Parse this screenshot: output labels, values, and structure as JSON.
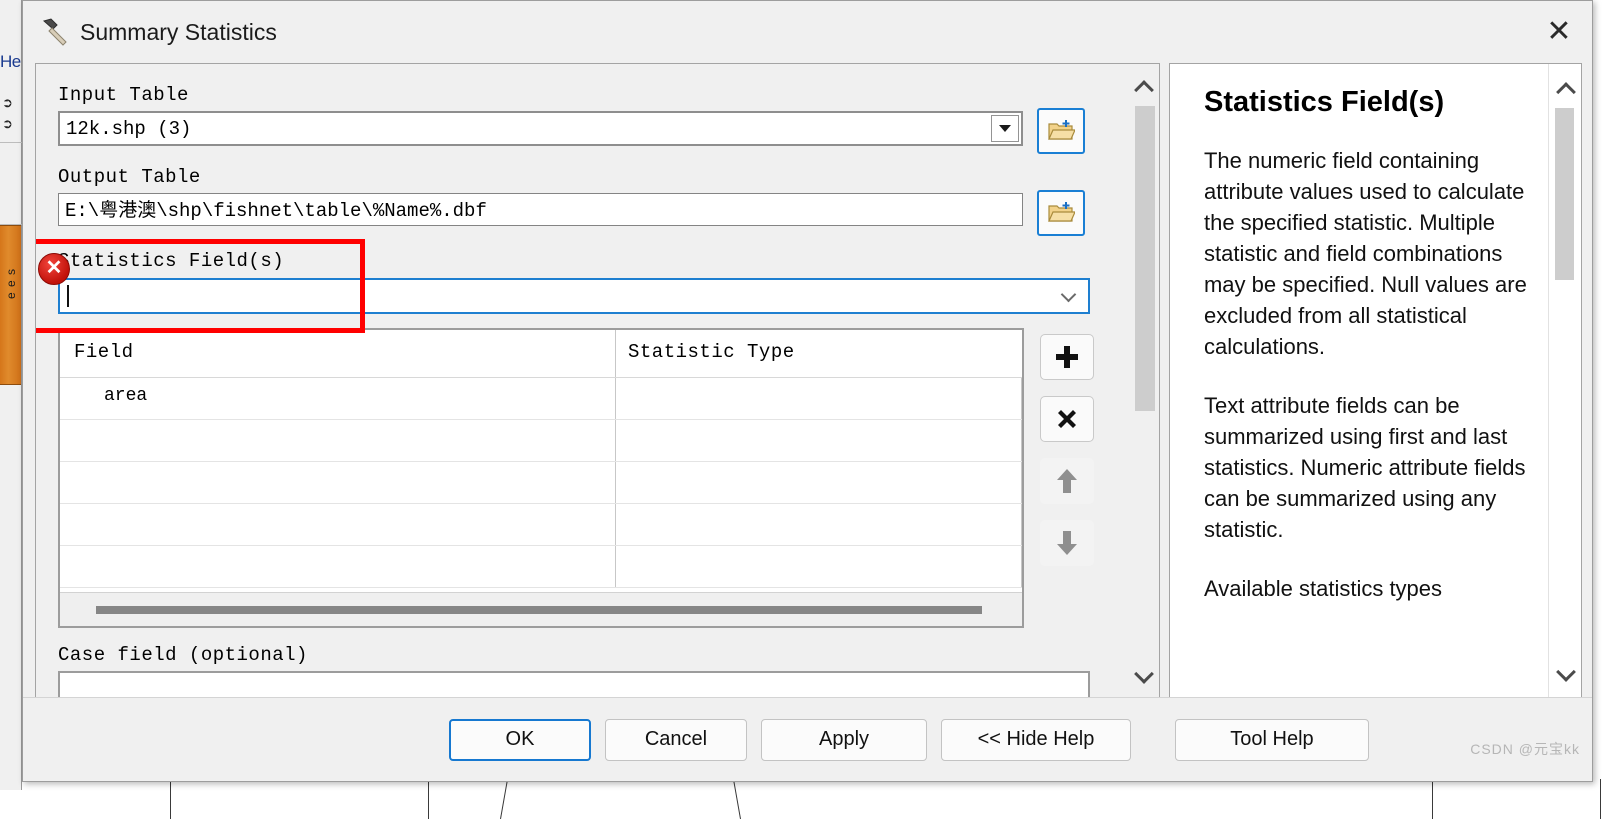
{
  "window": {
    "title": "Summary Statistics",
    "icon": "hammer-icon",
    "close_label": "✕"
  },
  "background": {
    "help_tab_text": "He",
    "pin_icons": [
      "✖",
      "✖"
    ],
    "orange_tab_text": "e  e  s"
  },
  "parameters": {
    "input_table": {
      "label": "Input Table",
      "value": "12k.shp (3)",
      "browse_label": "open-folder"
    },
    "output_table": {
      "label": "Output Table",
      "value": "E:\\粤港澳\\shp\\fishnet\\table\\%Name%.dbf",
      "browse_label": "open-folder"
    },
    "statistics_fields": {
      "label": "Statistics Field(s)",
      "value": "",
      "placeholder": "",
      "error": true,
      "error_marker": "✕"
    },
    "grid": {
      "columns": [
        "Field",
        "Statistic Type"
      ],
      "rows": [
        {
          "field": "area",
          "statistic_type": ""
        },
        {
          "field": "",
          "statistic_type": ""
        },
        {
          "field": "",
          "statistic_type": ""
        },
        {
          "field": "",
          "statistic_type": ""
        },
        {
          "field": "",
          "statistic_type": ""
        }
      ]
    },
    "grid_buttons": [
      {
        "name": "add-row-button",
        "glyph": "✚",
        "enabled": true
      },
      {
        "name": "delete-row-button",
        "glyph": "✖",
        "enabled": true
      },
      {
        "name": "move-up-button",
        "glyph": "↑",
        "enabled": false
      },
      {
        "name": "move-down-button",
        "glyph": "↓",
        "enabled": false
      }
    ],
    "case_field": {
      "label": "Case field (optional)",
      "value": ""
    }
  },
  "help": {
    "title": "Statistics Field(s)",
    "paragraphs": [
      "The numeric field containing attribute values used to calculate the specified statistic. Multiple statistic and field combinations may be specified. Null values are excluded from all statistical calculations.",
      "Text attribute fields can be summarized using first and last statistics. Numeric attribute fields can be summarized using any statistic.",
      "Available statistics types"
    ]
  },
  "buttons": {
    "ok": "OK",
    "cancel": "Cancel",
    "apply": "Apply",
    "hide_help": "<< Hide Help",
    "tool_help": "Tool Help"
  },
  "watermark": "CSDN @元宝kk",
  "colors": {
    "accent_blue": "#1678d0",
    "error_red": "#c1120a",
    "highlight_box": "#ff0000",
    "orange_tab": "#e08b2c"
  }
}
